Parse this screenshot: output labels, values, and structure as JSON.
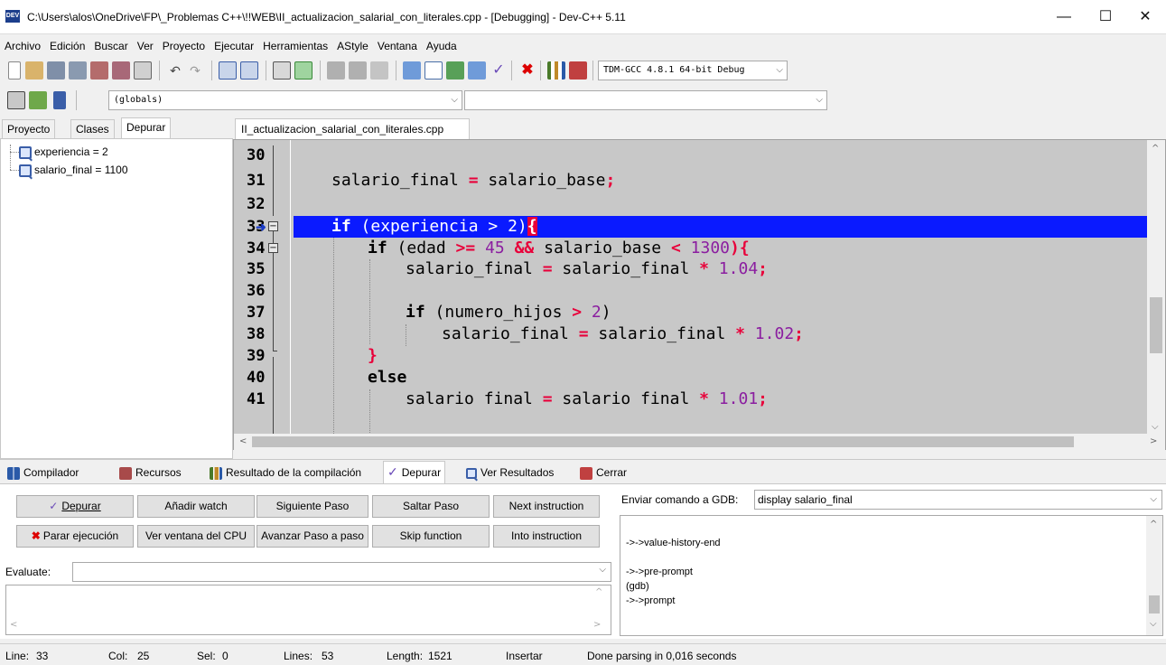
{
  "window": {
    "title": "C:\\Users\\alos\\OneDrive\\FP\\_Problemas C++\\!!WEB\\II_actualizacion_salarial_con_literales.cpp - [Debugging] - Dev-C++ 5.11",
    "minimize": "—",
    "maximize": "☐",
    "close": "✕"
  },
  "menu": [
    "Archivo",
    "Edición",
    "Buscar",
    "Ver",
    "Proyecto",
    "Ejecutar",
    "Herramientas",
    "AStyle",
    "Ventana",
    "Ayuda"
  ],
  "toolbar": {
    "compiler_select": "TDM-GCC 4.8.1 64-bit Debug",
    "scope_select": "(globals)",
    "function_select": ""
  },
  "left_tabs": [
    "Proyecto",
    "Clases",
    "Depurar"
  ],
  "watches": [
    {
      "label": "experiencia = 2"
    },
    {
      "label": "salario_final = 1100"
    }
  ],
  "editor": {
    "file_tab": "II_actualizacion_salarial_con_literales.cpp",
    "lines": [
      {
        "n": "30"
      },
      {
        "n": "31"
      },
      {
        "n": "32"
      },
      {
        "n": "33"
      },
      {
        "n": "34"
      },
      {
        "n": "35"
      },
      {
        "n": "36"
      },
      {
        "n": "37"
      },
      {
        "n": "38"
      },
      {
        "n": "39"
      },
      {
        "n": "40"
      },
      {
        "n": "41"
      }
    ],
    "code": {
      "l31_a": "salario_final ",
      "l31_op": "=",
      "l31_b": " salario_base",
      "l31_semi": ";",
      "l33_kw": "if",
      "l33_a": " (experiencia ",
      "l33_op": ">",
      "l33_b": " 2)",
      "l33_brace": "{",
      "l34_kw": "if",
      "l34_a": " (edad ",
      "l34_op1": ">=",
      "l34_num1": " 45",
      "l34_op2": " &&",
      "l34_b": " salario_base ",
      "l34_op3": "<",
      "l34_num2": " 1300",
      "l34_c": "){",
      "l35_a": "salario_final ",
      "l35_op1": "=",
      "l35_b": " salario_final ",
      "l35_op2": "*",
      "l35_num": " 1.04",
      "l35_semi": ";",
      "l37_kw": "if",
      "l37_a": " (numero_hijos ",
      "l37_op": ">",
      "l37_num": " 2",
      "l37_b": ")",
      "l38_a": "salario_final ",
      "l38_op1": "=",
      "l38_b": " salario_final ",
      "l38_op2": "*",
      "l38_num": " 1.02",
      "l38_semi": ";",
      "l39_brace": "}",
      "l40_kw": "else",
      "l41_a": "salario final ",
      "l41_op1": "=",
      "l41_b": " salario final ",
      "l41_op2": "*",
      "l41_num": " 1.01",
      "l41_semi": ";"
    }
  },
  "bottom_tabs": [
    "Compilador",
    "Recursos",
    "Resultado de la compilación",
    "Depurar",
    "Ver Resultados",
    "Cerrar"
  ],
  "debug": {
    "buttons": {
      "depurar": "Depurar",
      "add_watch": "Añadir watch",
      "next_step": "Siguiente Paso",
      "skip_step": "Saltar Paso",
      "next_instruction": "Next instruction",
      "stop": "Parar ejecución",
      "cpu_window": "Ver ventana del CPU",
      "step_into": "Avanzar Paso a paso",
      "skip_function": "Skip function",
      "into_instruction": "Into instruction"
    },
    "evaluate_label": "Evaluate:",
    "evaluate_value": "",
    "gdb_label": "Enviar comando a GDB:",
    "gdb_command": "display salario_final",
    "gdb_output": [
      "->->value-history-end",
      "",
      "->->pre-prompt",
      "(gdb)",
      "->->prompt"
    ]
  },
  "status": {
    "line_label": "Line:",
    "line_value": "33",
    "col_label": "Col:",
    "col_value": "25",
    "sel_label": "Sel:",
    "sel_value": "0",
    "lines_label": "Lines:",
    "lines_value": "53",
    "length_label": "Length:",
    "length_value": "1521",
    "mode": "Insertar",
    "message": "Done parsing in 0,016 seconds"
  },
  "colors": {
    "exec_line": "#0a1aff",
    "operator": "#e8003a",
    "number": "#8b1ea0",
    "editor_bg": "#c8c8c8"
  }
}
